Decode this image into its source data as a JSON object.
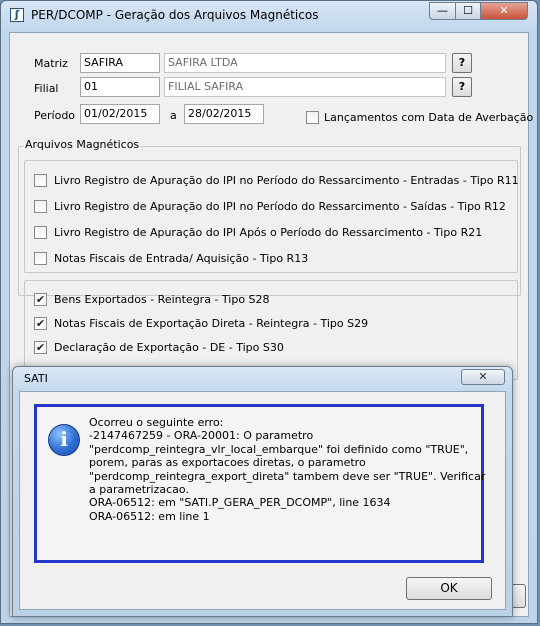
{
  "window": {
    "title": "PER/DCOMP - Geração dos Arquivos Magnéticos",
    "icon_glyph": "ʃ",
    "minimize_glyph": "—",
    "maximize_glyph": "☐",
    "close_glyph": "✕"
  },
  "form": {
    "matriz": {
      "label": "Matriz",
      "code": "SAFIRA",
      "name": "SAFIRA LTDA",
      "lookup_label": "?"
    },
    "filial": {
      "label": "Filial",
      "code": "01",
      "name": "FILIAL SAFIRA",
      "lookup_label": "?"
    },
    "periodo": {
      "label": "Período",
      "start": "01/02/2015",
      "separator": "a",
      "end": "28/02/2015"
    },
    "lancamentos": {
      "label": "Lançamentos com Data de Averbação",
      "checked": false
    }
  },
  "arquivos": {
    "group_title": "Arquivos Magnéticos",
    "ipi_items": [
      {
        "label": "Livro Registro de Apuração do IPI no Período do Ressarcimento - Entradas - Tipo R11",
        "checked": false
      },
      {
        "label": "Livro Registro de Apuração do IPI no Período do Ressarcimento - Saídas - Tipo R12",
        "checked": false
      },
      {
        "label": "Livro Registro de Apuração do IPI Após o Período do Ressarcimento - Tipo R21",
        "checked": false
      },
      {
        "label": "Notas Fiscais de Entrada/ Aquisição - Tipo R13",
        "checked": false
      }
    ],
    "reintegra_items": [
      {
        "label": "Bens Exportados - Reintegra - Tipo S28",
        "checked": true
      },
      {
        "label": "Notas Fiscais de Exportação Direta - Reintegra - Tipo S29",
        "checked": true
      },
      {
        "label": "Declaração de Exportação - DE - Tipo S30",
        "checked": true
      }
    ]
  },
  "dialog": {
    "title": "SATI",
    "close_glyph": "✕",
    "icon_glyph": "i",
    "message_lines": [
      "Ocorreu o seguinte erro:",
      "-2147467259 - ORA-20001: O parametro",
      "\"perdcomp_reintegra_vlr_local_embarque\" foi definido como \"TRUE\",",
      "porem, paras as exportacoes diretas, o parametro",
      "\"perdcomp_reintegra_export_direta\" tambem deve ser \"TRUE\". Verificar",
      "a parametrizacao.",
      "ORA-06512: em \"SATI.P_GERA_PER_DCOMP\", line 1634",
      "ORA-06512: em line 1"
    ],
    "ok_label": "OK"
  },
  "colors": {
    "dialog_border_accent": "#2435c9",
    "close_button": "#c7533b",
    "window_frame": "#c2d6ec"
  }
}
